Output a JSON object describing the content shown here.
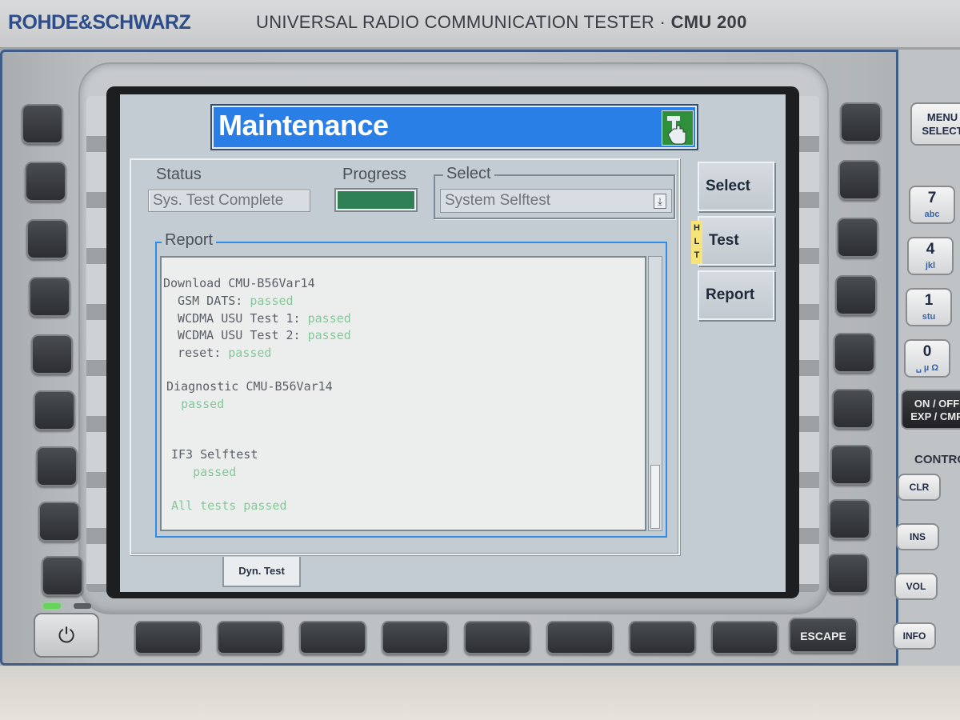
{
  "device": {
    "brand": "ROHDE&SCHWARZ",
    "model_title": "UNIVERSAL RADIO COMMUNICATION TESTER",
    "model_sep": "·",
    "model_number": "CMU 200"
  },
  "screen": {
    "title": "Maintenance",
    "status": {
      "label": "Status",
      "value": "Sys. Test Complete"
    },
    "progress": {
      "label": "Progress",
      "value": 1.0
    },
    "select": {
      "label": "Select",
      "value": "System Selftest"
    },
    "report": {
      "label": "Report",
      "lines": [
        {
          "text": "Download CMU-B56Var14",
          "kind": "head"
        },
        {
          "prefix": "  GSM DATS: ",
          "status": "passed"
        },
        {
          "prefix": "  WCDMA USU Test 1: ",
          "status": "passed"
        },
        {
          "prefix": "  WCDMA USU Test 2: ",
          "status": "passed"
        },
        {
          "prefix": "  reset: ",
          "status": "passed"
        },
        {
          "text": "Diagnostic CMU-B56Var14",
          "kind": "head"
        },
        {
          "prefix": "  ",
          "status": "passed"
        },
        {
          "text": "IF3 Selftest",
          "kind": "head"
        },
        {
          "prefix": "   ",
          "status": "passed"
        },
        {
          "text": "All tests passed",
          "kind": "pass"
        }
      ]
    },
    "side_buttons": [
      "Select",
      "Test",
      "Report"
    ],
    "hlt_badge": "HLT",
    "tabs": [
      "Dyn. Test"
    ]
  },
  "hardware": {
    "escape_label": "ESCAPE",
    "menu_select": [
      "MENU",
      "SELECT"
    ],
    "numpad": [
      {
        "digit": "7",
        "sub": "abc"
      },
      {
        "digit": "4",
        "sub": "jkl"
      },
      {
        "digit": "1",
        "sub": "stu"
      },
      {
        "digit": "0",
        "sub": "␣ µ Ω"
      }
    ],
    "onoff": [
      "ON / OFF",
      "EXP / CMP"
    ],
    "control_label": "CONTROL",
    "control_keys": [
      "CLR",
      "INS",
      "VOL",
      "INFO"
    ]
  }
}
